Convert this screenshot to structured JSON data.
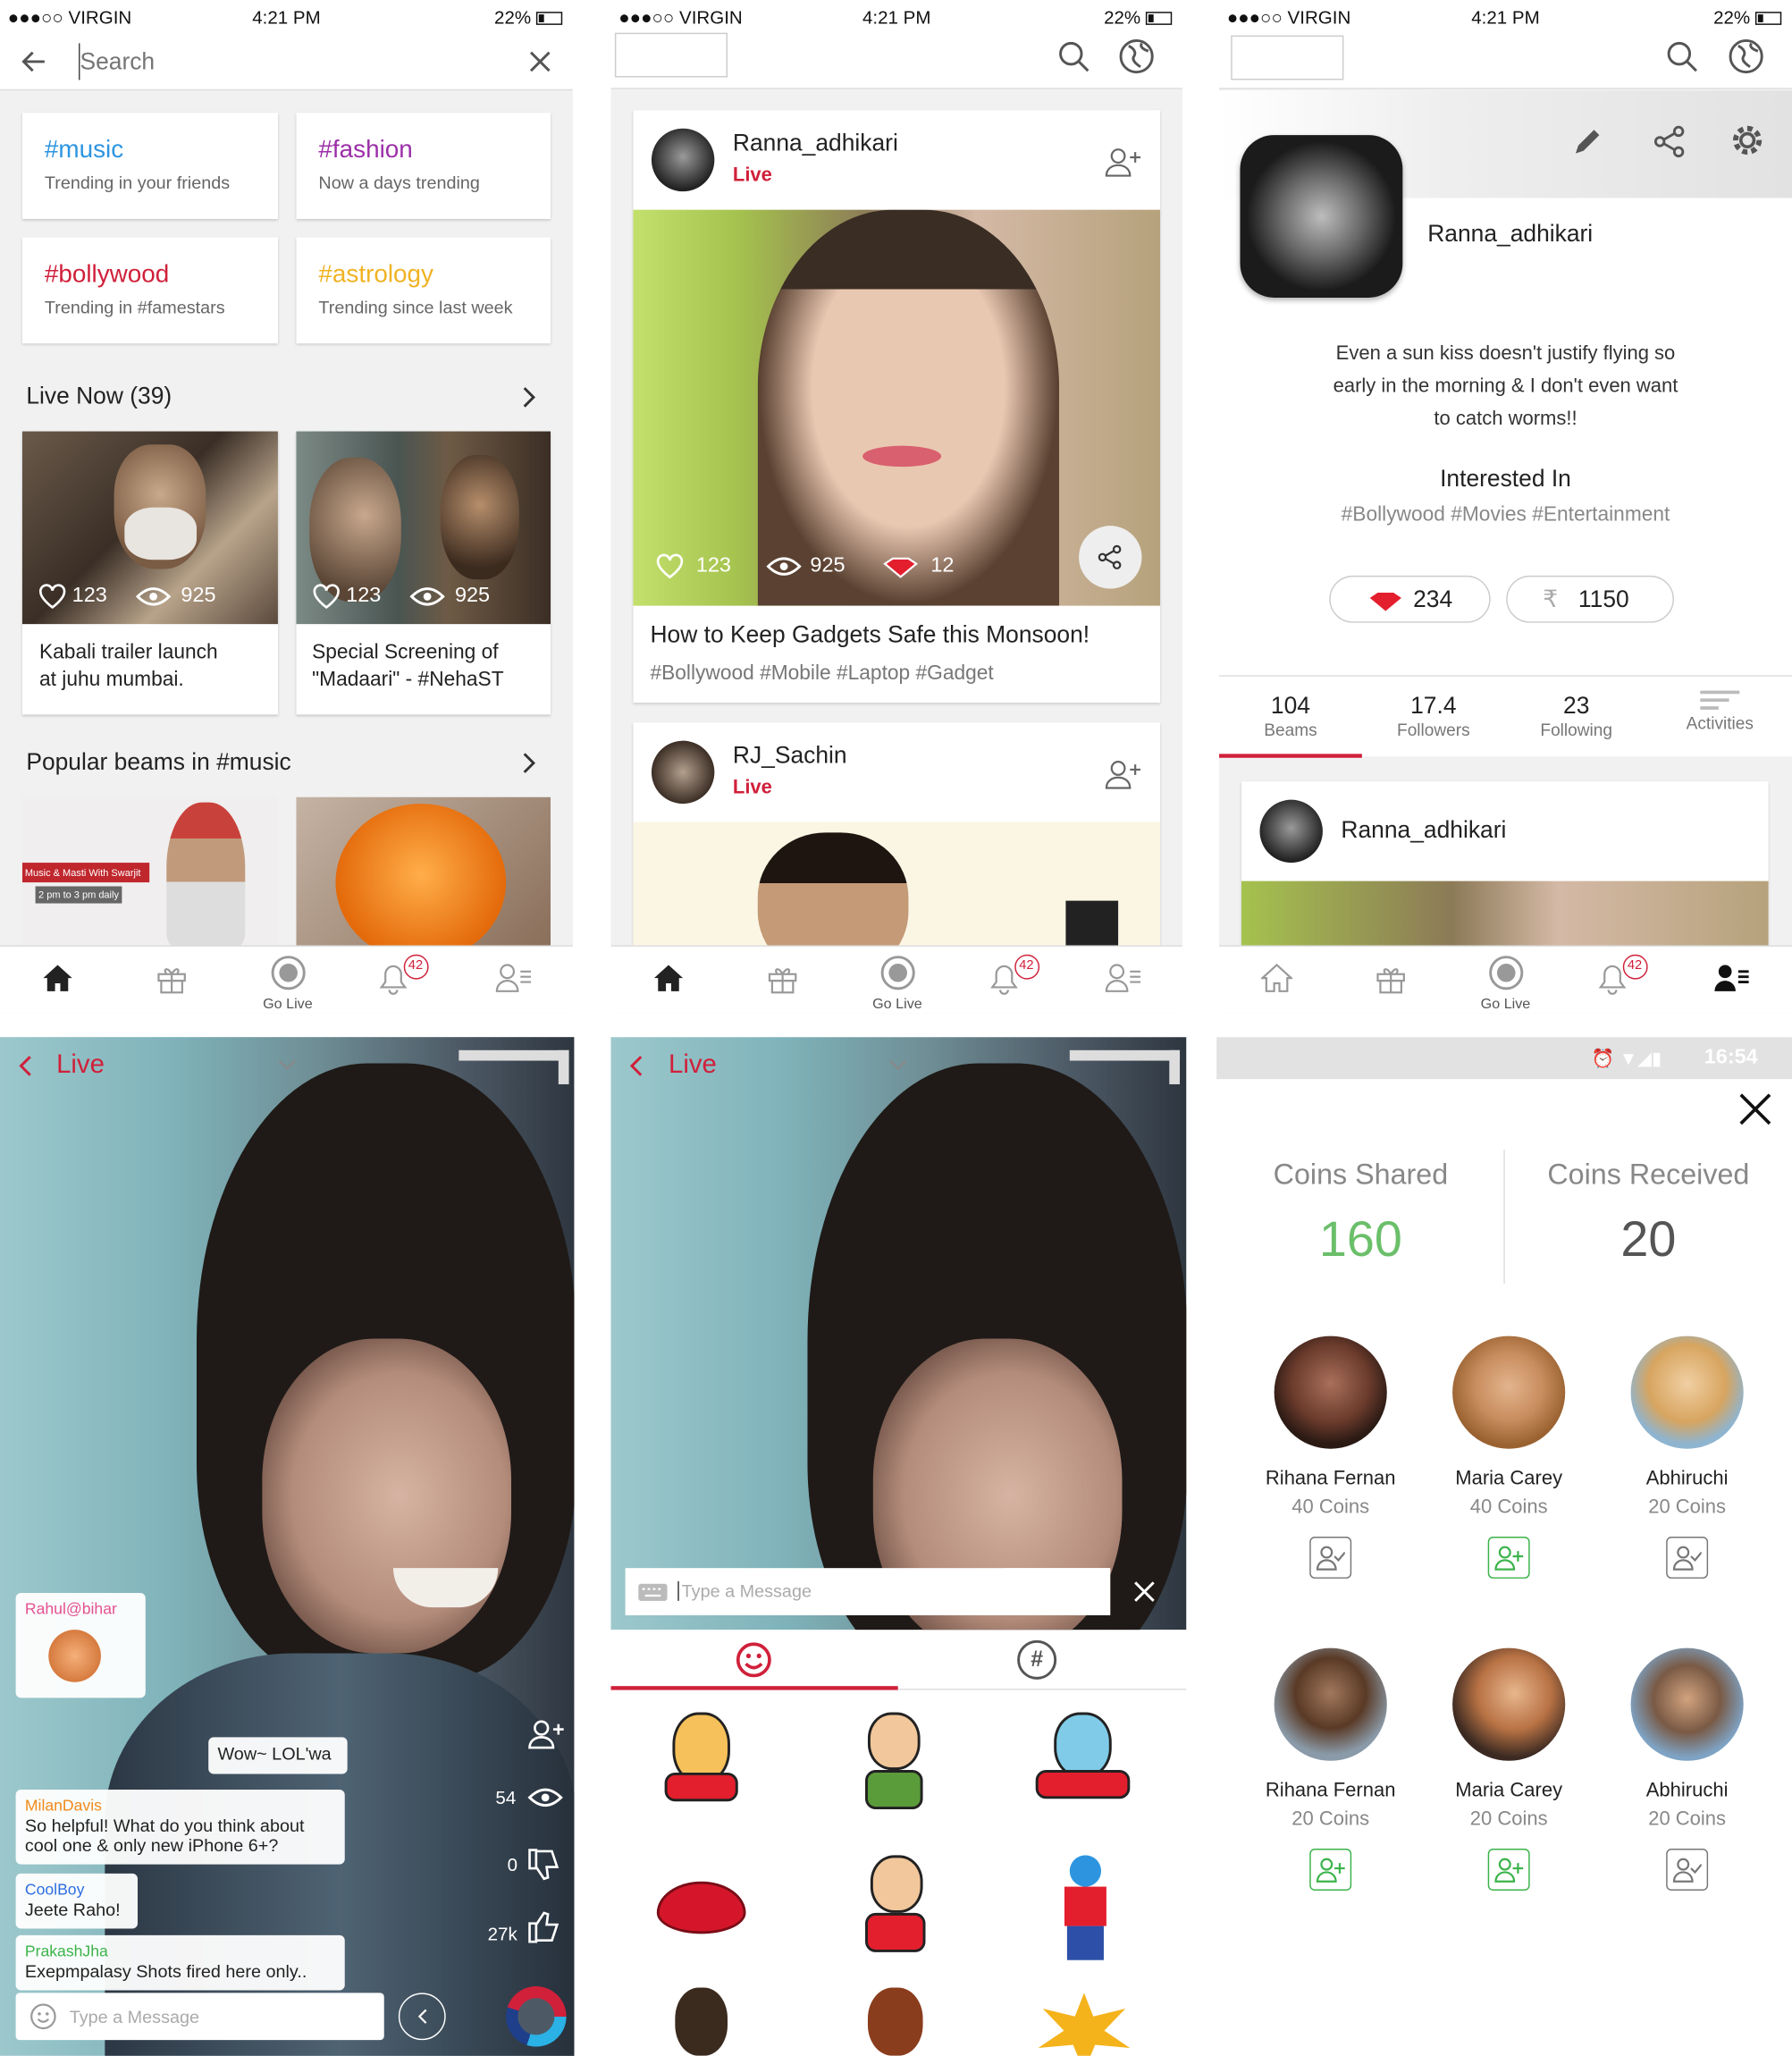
{
  "status": {
    "carrier": "●●●○○ VIRGIN",
    "time": "4:21 PM",
    "battery": "22%",
    "android_time": "16:54"
  },
  "search": {
    "placeholder": "Search"
  },
  "tags": [
    {
      "tag": "#music",
      "sub": "Trending in your friends",
      "color": "#2d95e0"
    },
    {
      "tag": "#fashion",
      "sub": "Now a days trending",
      "color": "#9b2fa8"
    },
    {
      "tag": "#bollywood",
      "sub": "Trending in #famestars",
      "color": "#d0203a"
    },
    {
      "tag": "#astrology",
      "sub": "Trending since last week",
      "color": "#f0b323"
    }
  ],
  "live_now": {
    "title": "Live Now (39)",
    "items": [
      {
        "likes": "123",
        "views": "925",
        "title1": "Kabali trailer launch",
        "title2": "at juhu mumbai."
      },
      {
        "likes": "123",
        "views": "925",
        "title1": "Special Screening of",
        "title2": "\"Madaari\" - #NehaST"
      }
    ]
  },
  "popular": {
    "title": "Popular beams in #music",
    "banner1": "Music & Masti With Swarjit",
    "banner2": "2 pm to 3 pm daily"
  },
  "nav": {
    "go_live": "Go Live",
    "badge": "42"
  },
  "feed": {
    "post1": {
      "user": "Ranna_adhikari",
      "live": "Live",
      "likes": "123",
      "views": "925",
      "gems": "12",
      "title": "How to Keep Gadgets Safe this Monsoon!",
      "tags": "#Bollywood #Mobile #Laptop #Gadget"
    },
    "post2": {
      "user": "RJ_Sachin",
      "live": "Live"
    }
  },
  "profile": {
    "user": "Ranna_adhikari",
    "bio1": "Even a sun kiss doesn't justify flying so",
    "bio2": "early in the morning & I don't even want",
    "bio3": "to catch worms!!",
    "interested": "Interested In",
    "interests": "#Bollywood #Movies #Entertainment",
    "gems": "234",
    "rupees": "1150",
    "rupee_sym": "₹",
    "stats": [
      {
        "v": "104",
        "l": "Beams"
      },
      {
        "v": "17.4",
        "l": "Followers"
      },
      {
        "v": "23",
        "l": "Following"
      },
      {
        "v": "",
        "l": "Activities"
      }
    ],
    "post_user": "Ranna_adhikari"
  },
  "livechat": {
    "header": "Live",
    "c1_user": "Rahul@bihar",
    "c2": "Wow~ LOL'wa",
    "c3_user": "MilanDavis",
    "c3a": "So helpful! What do you think about",
    "c3b": "cool one & only  new iPhone 6+?",
    "c4_user": "CoolBoy",
    "c4": "Jeete Raho!",
    "c5_user": "PrakashJha",
    "c5": "Exepmpalasy Shots fired here only..",
    "views": "54",
    "dislikes": "0",
    "likes": "27k",
    "placeholder": "Type a Message"
  },
  "sticker": {
    "header": "Live",
    "placeholder": "Type a Message",
    "hash": "#"
  },
  "coins": {
    "shared_label": "Coins Shared",
    "shared": "160",
    "received_label": "Coins Received",
    "received": "20",
    "people": [
      {
        "name": "Rihana Fernan",
        "coins": "40 Coins"
      },
      {
        "name": "Maria Carey",
        "coins": "40 Coins"
      },
      {
        "name": "Abhiruchi",
        "coins": "20 Coins"
      },
      {
        "name": "Rihana Fernan",
        "coins": "20 Coins"
      },
      {
        "name": "Maria Carey",
        "coins": "20 Coins"
      },
      {
        "name": "Abhiruchi",
        "coins": "20 Coins"
      }
    ]
  },
  "colors": {
    "accent": "#d0203a",
    "green": "#3bb34a"
  }
}
